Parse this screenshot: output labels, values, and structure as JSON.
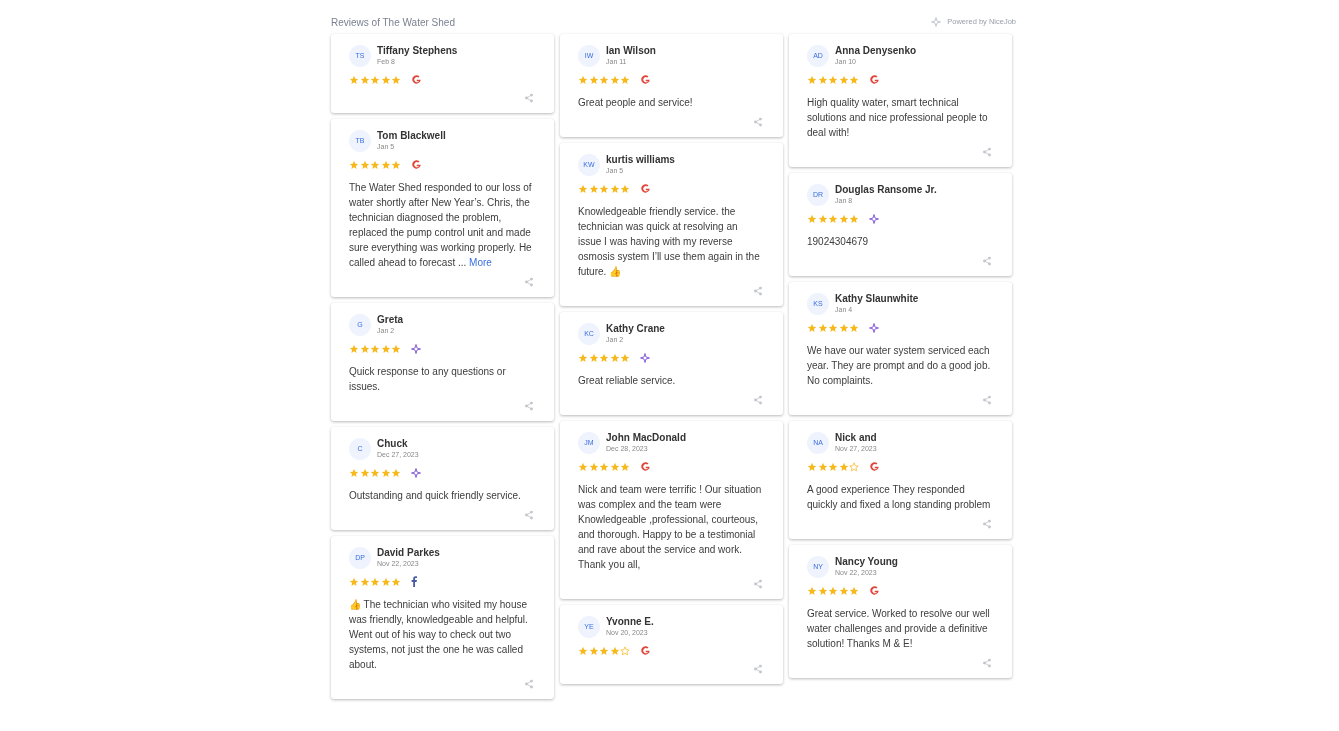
{
  "header": {
    "title": "Reviews of The Water Shed",
    "powered_by": "Powered by NiceJob"
  },
  "columns": [
    {
      "cards": [
        {
          "initials": "TS",
          "name": "Tiffany Stephens",
          "date": "Feb 8",
          "stars": 5,
          "kind": "google"
        },
        {
          "initials": "TB",
          "name": "Tom Blackwell",
          "date": "Jan 5",
          "stars": 5,
          "kind": "google",
          "text": "The Water Shed responded to our loss of water shortly after New Year’s. Chris, the technician diagnosed the problem, replaced the pump control unit and made sure everything was working properly. He called ahead to forecast ...",
          "more": "More"
        },
        {
          "initials": "G",
          "name": "Greta",
          "date": "Jan 2",
          "stars": 5,
          "kind": "nicejob",
          "text": "Quick response to any questions or issues."
        },
        {
          "initials": "C",
          "name": "Chuck",
          "date": "Dec 27, 2023",
          "stars": 5,
          "kind": "nicejob",
          "text": "Outstanding and quick friendly service."
        },
        {
          "initials": "DP",
          "name": "David Parkes",
          "date": "Nov 22, 2023",
          "stars": 5,
          "kind": "facebook",
          "text": "👍 The technician who visited my house was friendly, knowledgeable and helpful. Went out of his way to check out two systems, not just the one he was called about."
        }
      ]
    },
    {
      "cards": [
        {
          "initials": "IW",
          "name": "Ian Wilson",
          "date": "Jan 11",
          "stars": 5,
          "kind": "google",
          "text": "Great people and service!"
        },
        {
          "initials": "KW",
          "name": "kurtis williams",
          "date": "Jan 5",
          "stars": 5,
          "kind": "google",
          "text": "Knowledgeable friendly service. the technician was quick at resolving an issue I was having with my reverse osmosis system I’ll use them again in the future. 👍"
        },
        {
          "initials": "KC",
          "name": "Kathy Crane",
          "date": "Jan 2",
          "stars": 5,
          "kind": "nicejob",
          "text": "Great reliable service."
        },
        {
          "initials": "JM",
          "name": "John MacDonald",
          "date": "Dec 28, 2023",
          "stars": 5,
          "kind": "google",
          "text": "Nick and team were terrific ! Our situation was complex and the team were Knowledgeable ,professional, courteous, and thorough. Happy to be a testimonial and rave about the service and work. Thank you all,"
        },
        {
          "initials": "YE",
          "name": "Yvonne E.",
          "date": "Nov 20, 2023",
          "stars": 4,
          "kind": "google"
        }
      ]
    },
    {
      "cards": [
        {
          "initials": "AD",
          "name": "Anna Denysenko",
          "date": "Jan 10",
          "stars": 5,
          "kind": "google",
          "text": "High quality water, smart technical solutions and nice professional people to deal with!"
        },
        {
          "initials": "DR",
          "name": "Douglas Ransome Jr.",
          "date": "Jan 8",
          "stars": 5,
          "kind": "nicejob",
          "text": "19024304679"
        },
        {
          "initials": "KS",
          "name": "Kathy Slaunwhite",
          "date": "Jan 4",
          "stars": 5,
          "kind": "nicejob",
          "text": "We have our water system serviced each year. They are prompt and do a good job. No complaints."
        },
        {
          "initials": "NA",
          "name": "Nick and",
          "date": "Nov 27, 2023",
          "stars": 4,
          "kind": "google",
          "text": "A good experience They responded quickly and fixed a long standing problem"
        },
        {
          "initials": "NY",
          "name": "Nancy Young",
          "date": "Nov 22, 2023",
          "stars": 5,
          "kind": "google",
          "text": "Great service. Worked to resolve our well water challenges and provide a definitive solution! Thanks M & E!"
        }
      ]
    }
  ]
}
